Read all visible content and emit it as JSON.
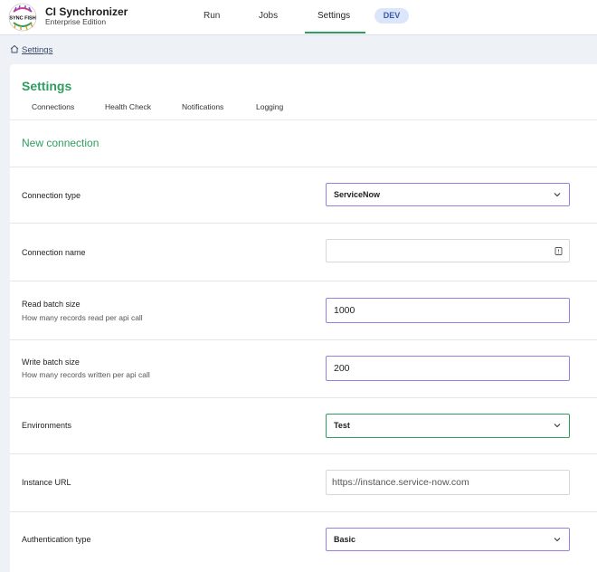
{
  "app": {
    "title": "CI Synchronizer",
    "edition": "Enterprise Edition",
    "logo_text": "SYNC FISH"
  },
  "nav": {
    "items": [
      {
        "label": "Run"
      },
      {
        "label": "Jobs"
      },
      {
        "label": "Settings"
      }
    ],
    "active": "Settings",
    "env_badge": "DEV"
  },
  "breadcrumb": {
    "label": "Settings"
  },
  "page": {
    "title": "Settings",
    "tabs": [
      {
        "label": "Connections"
      },
      {
        "label": "Health Check"
      },
      {
        "label": "Notifications"
      },
      {
        "label": "Logging"
      }
    ],
    "section_title": "New connection"
  },
  "form": {
    "connection_type": {
      "label": "Connection type",
      "value": "ServiceNow"
    },
    "connection_name": {
      "label": "Connection name",
      "value": ""
    },
    "read_batch": {
      "label": "Read batch size",
      "hint": "How many records read per api call",
      "value": "1000"
    },
    "write_batch": {
      "label": "Write batch size",
      "hint": "How many records written per api call",
      "value": "200"
    },
    "environments": {
      "label": "Environments",
      "value": "Test"
    },
    "instance_url": {
      "label": "Instance URL",
      "placeholder": "https://instance.service-now.com"
    },
    "auth_type": {
      "label": "Authentication type",
      "value": "Basic"
    }
  },
  "colors": {
    "accent": "#2e9d5e",
    "focus_border": "#9b7fe0",
    "badge_bg": "#dbe6fb"
  }
}
